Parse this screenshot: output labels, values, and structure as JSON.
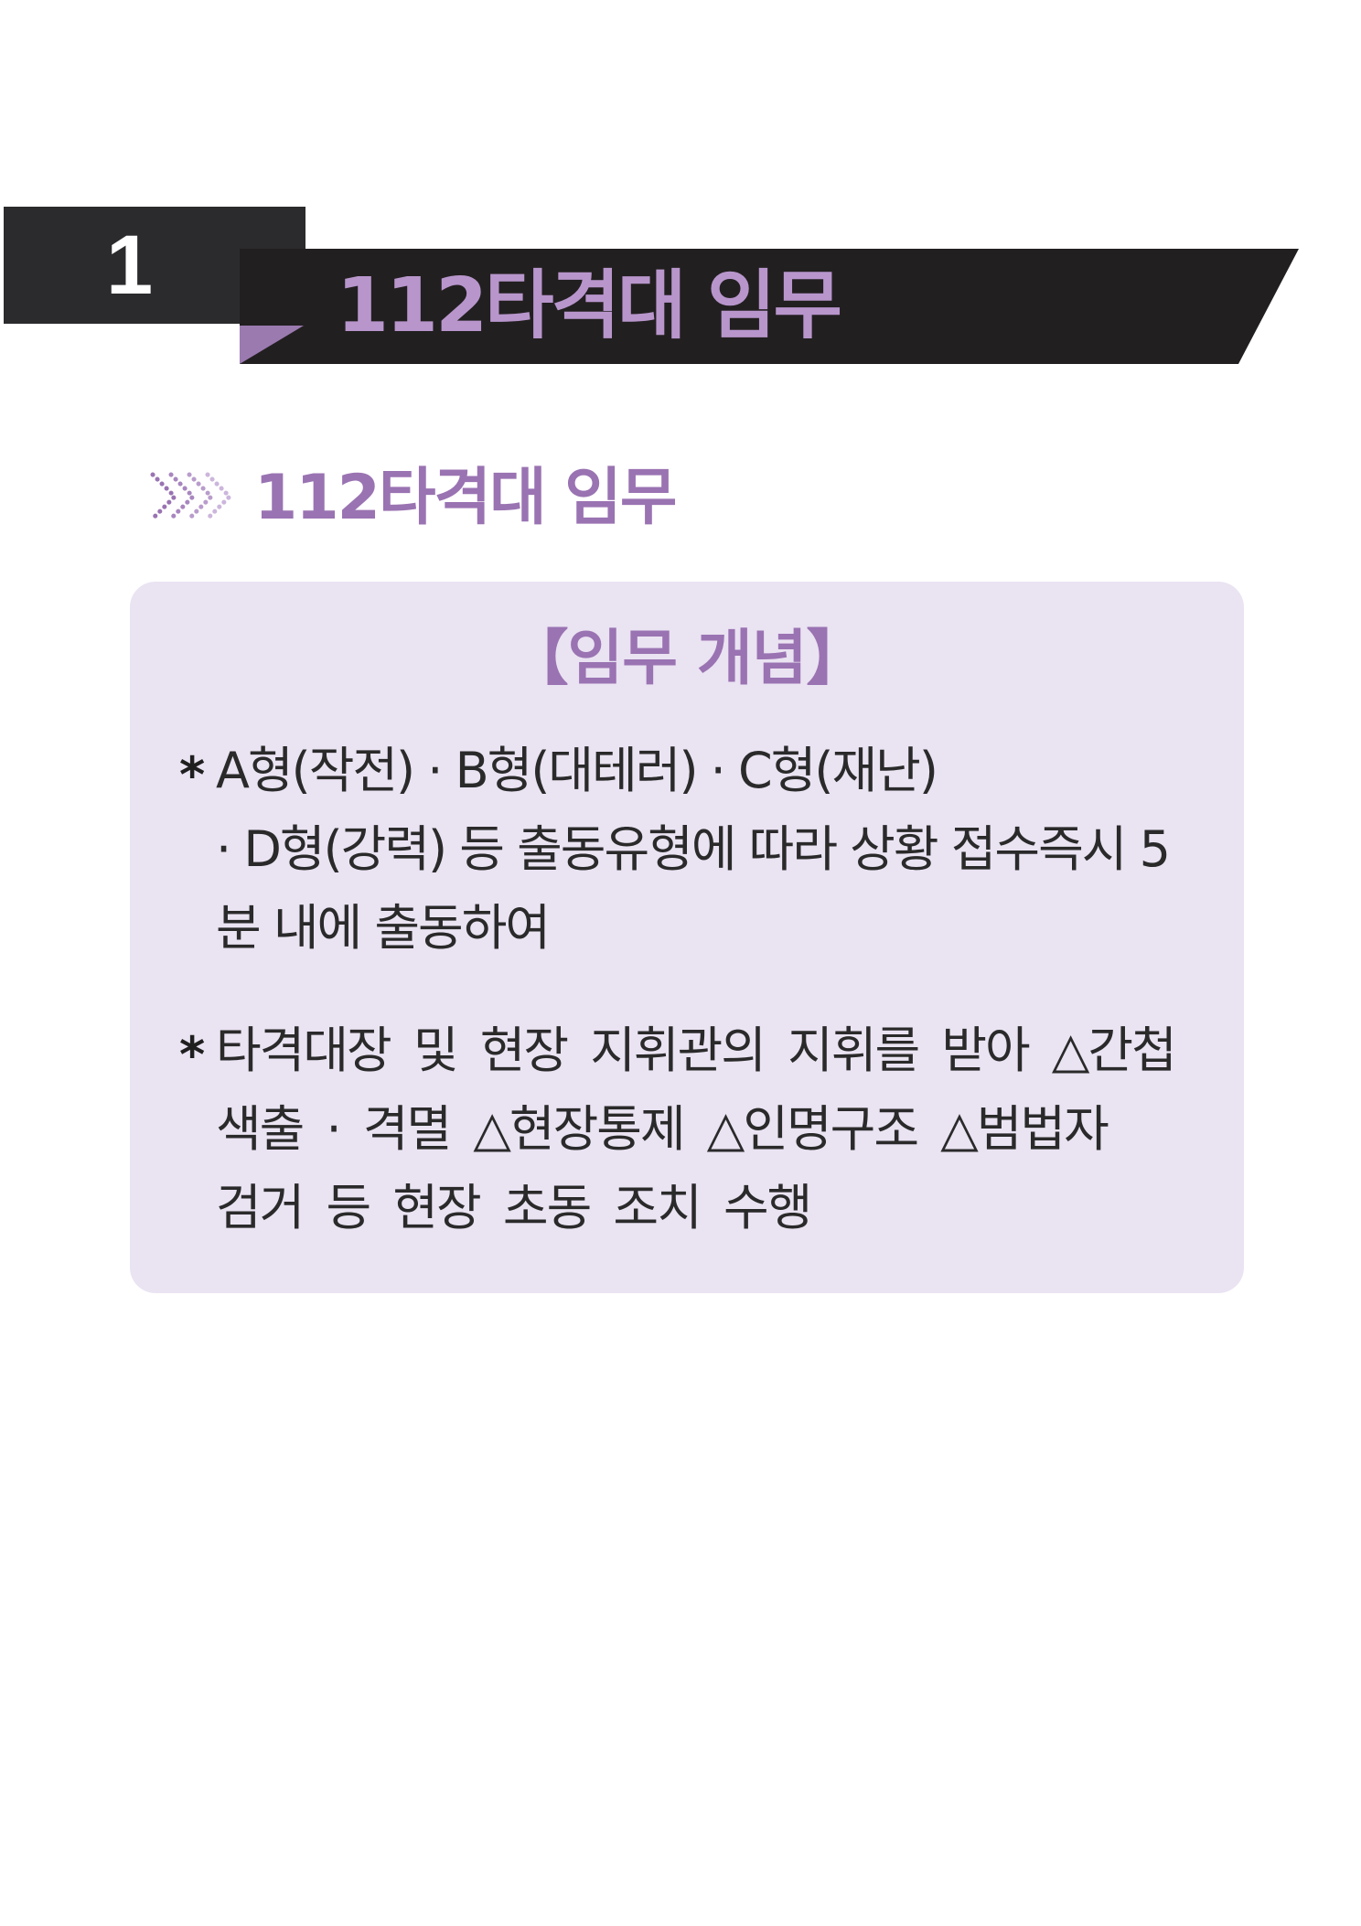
{
  "chapter": {
    "number": "1",
    "title": "112타격대 임무"
  },
  "section": {
    "title": "112타격대 임무"
  },
  "box": {
    "heading": "【임무 개념】",
    "bullets": [
      {
        "mark": "*",
        "lines": [
          "A형(작전) · B형(대테러) · C형(재난)",
          "· D형(강력) 등 출동유형에 따라 상황 접수즉시 5",
          "분 내에 출동하여"
        ]
      },
      {
        "mark": "*",
        "lines": [
          "타격대장 및 현장 지휘관의 지휘를 받아 △간첩",
          "색출 · 격멸 △현장통제 △인명구조 △범법자",
          "검거 등 현장 초동 조치 수행"
        ]
      }
    ]
  },
  "colors": {
    "banner_dark": "#221f20",
    "accent_purple": "#9a73b2",
    "box_background": "#eae3f2"
  },
  "icons": {
    "section_marker": "chevron-arrows-icon"
  }
}
